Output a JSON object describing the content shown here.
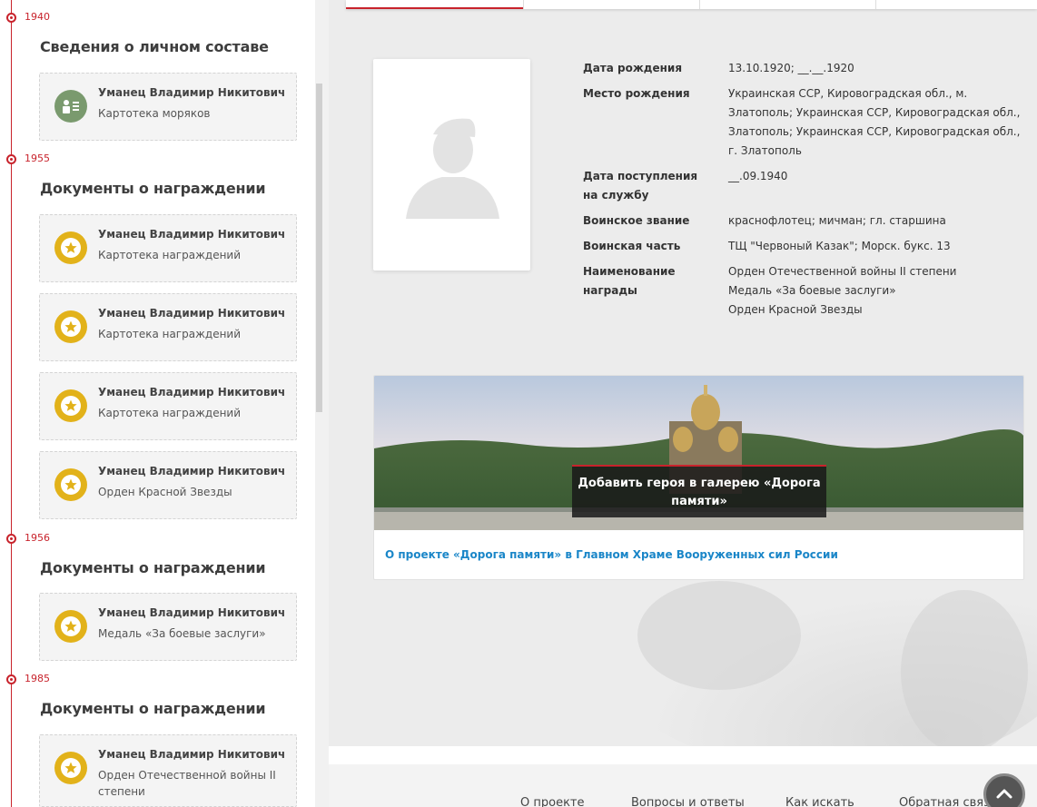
{
  "timeline": [
    {
      "year": "1940",
      "section": "Сведения о личном составе",
      "cards": [
        {
          "name": "Уманец Владимир Никитович",
          "type": "Картотека моряков",
          "icon": "personnel-card-icon"
        }
      ]
    },
    {
      "year": "1955",
      "section": "Документы о награждении",
      "cards": [
        {
          "name": "Уманец Владимир Никитович",
          "type": "Картотека награждений",
          "icon": "medal-icon"
        },
        {
          "name": "Уманец Владимир Никитович",
          "type": "Картотека награждений",
          "icon": "medal-icon"
        },
        {
          "name": "Уманец Владимир Никитович",
          "type": "Картотека награждений",
          "icon": "medal-icon"
        },
        {
          "name": "Уманец Владимир Никитович",
          "type": "Орден Красной Звезды",
          "icon": "medal-icon"
        }
      ]
    },
    {
      "year": "1956",
      "section": "Документы о награждении",
      "cards": [
        {
          "name": "Уманец Владимир Никитович",
          "type": "Медаль «За боевые заслуги»",
          "icon": "medal-icon"
        }
      ]
    },
    {
      "year": "1985",
      "section": "Документы о награждении",
      "cards": [
        {
          "name": "Уманец Владимир Никитович",
          "type": "Орден Отечественной войны II степени",
          "icon": "medal-icon"
        }
      ]
    }
  ],
  "profile": {
    "fields": [
      {
        "label": "Дата рождения",
        "value": "13.10.1920; __.__.1920"
      },
      {
        "label": "Место рождения",
        "value": "Украинская ССР, Кировоградская обл., м. Златополь; Украинская ССР, Кировоградская обл., Златополь; Украинская ССР, Кировоградская обл., г. Златополь"
      },
      {
        "label": "Дата поступления на службу",
        "value": "__.09.1940"
      },
      {
        "label": "Воинское звание",
        "value": "краснофлотец; мичман; гл. старшина"
      },
      {
        "label": "Воинская часть",
        "value": "ТЩ \"Червоный Казак\"; Морск. букс. 13"
      },
      {
        "label": "Наименование награды",
        "value_lines": [
          "Орден Отечественной войны II степени",
          "Медаль «За боевые заслуги»",
          "Орден Красной Звезды"
        ]
      }
    ]
  },
  "banner": {
    "cta": "Добавить героя в галерею «Дорога памяти»",
    "link": "О проекте «Дорога памяти» в Главном Храме Вооруженных сил России"
  },
  "footer": {
    "links": [
      "О проекте",
      "Вопросы и ответы",
      "Как искать",
      "Обратная связь"
    ]
  },
  "colors": {
    "accent": "#c8232c",
    "medal_gold": "#e2b21a",
    "personnel_green": "#7a9a6e",
    "link_blue": "#1a86c8"
  }
}
